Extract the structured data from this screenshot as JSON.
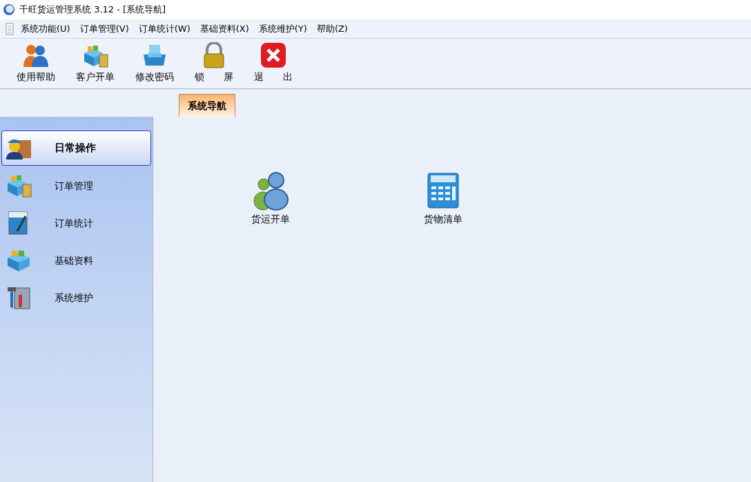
{
  "window": {
    "title": "千旺货运管理系统 3.12 - [系统导航]"
  },
  "menu": [
    "系统功能(U)",
    "订单管理(V)",
    "订单统计(W)",
    "基础资料(X)",
    "系统维护(Y)",
    "帮助(Z)"
  ],
  "toolbar": [
    "使用帮助",
    "客户开单",
    "修改密码",
    "锁　　屏",
    "退　　出"
  ],
  "tabs": [
    {
      "label": "系统导航",
      "selected": true
    }
  ],
  "sidebar": {
    "items": [
      {
        "label": "日常操作",
        "selected": true
      },
      {
        "label": "订单管理",
        "selected": false
      },
      {
        "label": "订单统计",
        "selected": false
      },
      {
        "label": "基础资料",
        "selected": false
      },
      {
        "label": "系统维护",
        "selected": false
      }
    ]
  },
  "shortcuts": [
    "货运开单",
    "货物清单"
  ]
}
